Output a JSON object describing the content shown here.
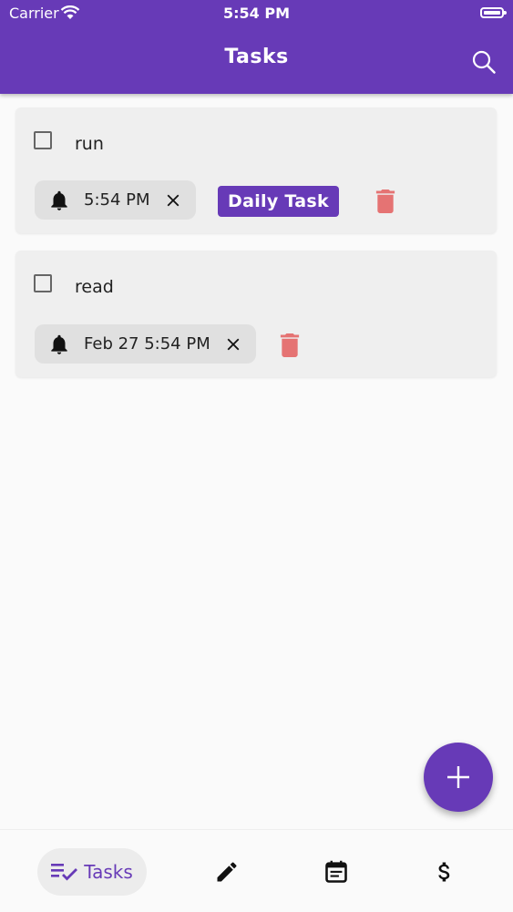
{
  "status_bar": {
    "carrier": "Carrier",
    "time": "5:54 PM"
  },
  "app_bar": {
    "title": "Tasks",
    "search_icon": "search-icon"
  },
  "colors": {
    "primary": "#673ab7",
    "delete": "#e57373",
    "card_bg": "#efefef",
    "chip_bg": "#e0e0e0"
  },
  "tasks": [
    {
      "text": "run",
      "reminder": "5:54 PM",
      "tag": "Daily Task",
      "checked": false
    },
    {
      "text": "read",
      "reminder": "Feb 27 5:54 PM",
      "checked": false
    }
  ],
  "fab": {
    "icon": "plus-icon"
  },
  "bottom_nav": {
    "items": [
      {
        "label": "Tasks",
        "icon": "checklist-icon",
        "active": true
      },
      {
        "icon": "pencil-icon"
      },
      {
        "icon": "calendar-note-icon"
      },
      {
        "icon": "dollar-icon"
      }
    ]
  }
}
